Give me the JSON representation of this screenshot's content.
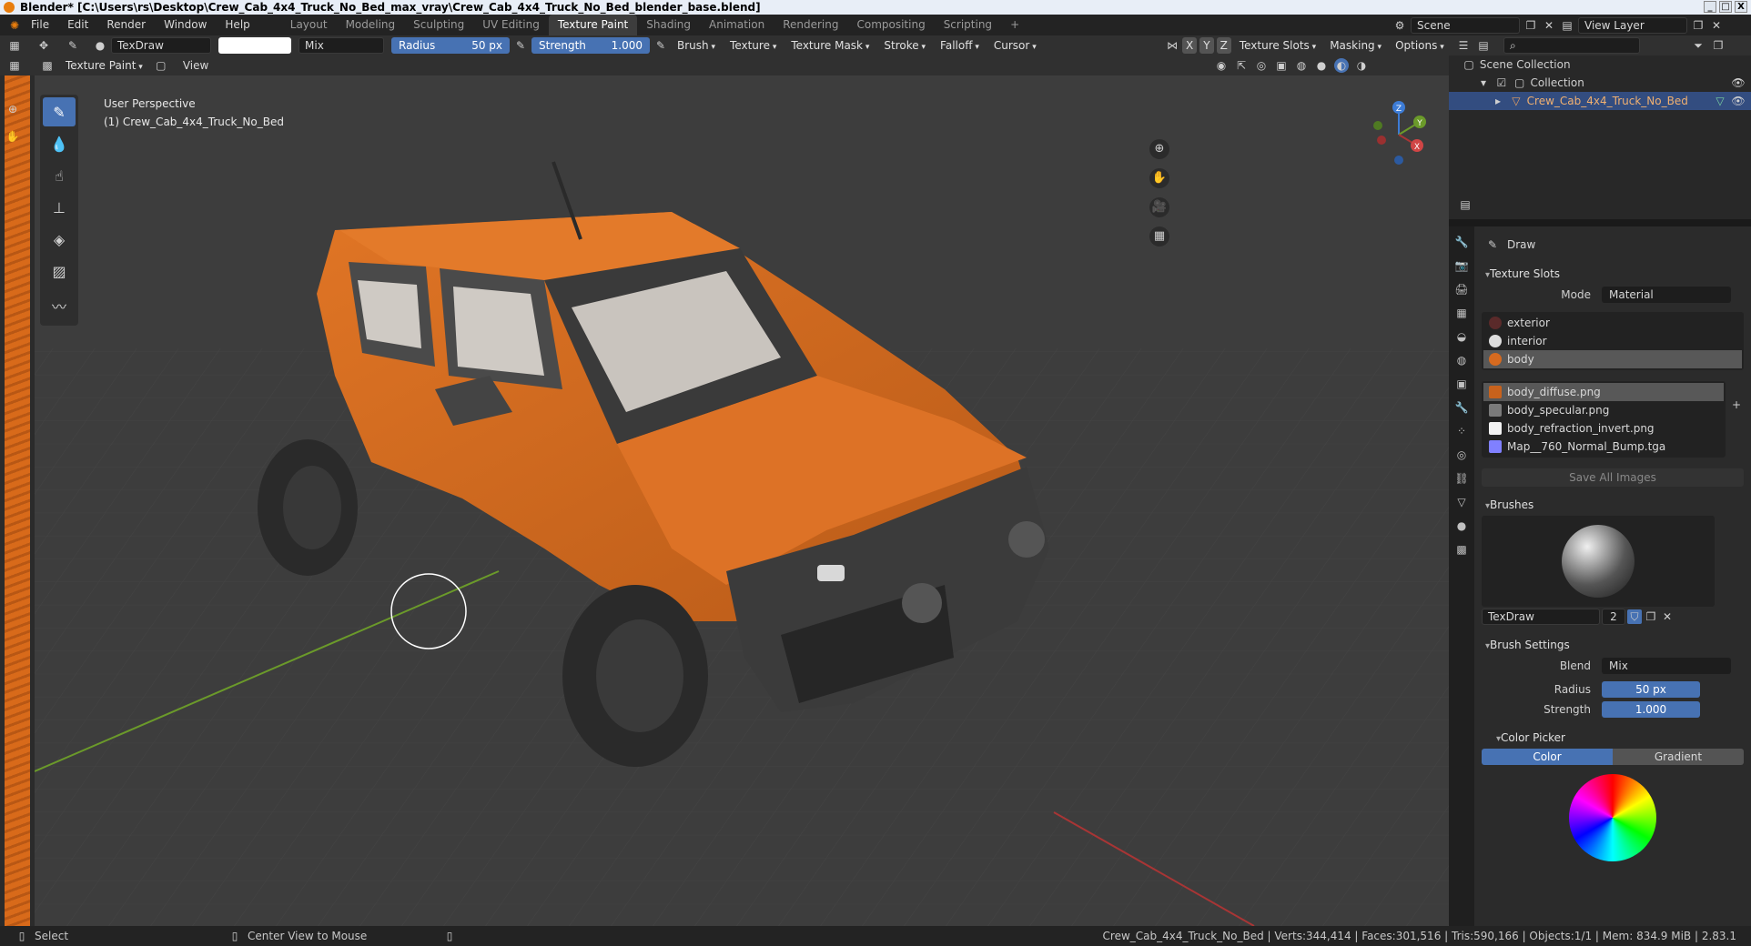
{
  "window": {
    "title": "Blender* [C:\\Users\\rs\\Desktop\\Crew_Cab_4x4_Truck_No_Bed_max_vray\\Crew_Cab_4x4_Truck_No_Bed_blender_base.blend]",
    "controls": [
      "_",
      "□",
      "X"
    ]
  },
  "menu": {
    "items": [
      "File",
      "Edit",
      "Render",
      "Window",
      "Help"
    ],
    "workspaces": [
      "Layout",
      "Modeling",
      "Sculpting",
      "UV Editing",
      "Texture Paint",
      "Shading",
      "Animation",
      "Rendering",
      "Compositing",
      "Scripting"
    ],
    "active_workspace": "Texture Paint",
    "add_workspace": "+",
    "scene_label": "Scene",
    "view_layer_label": "View Layer"
  },
  "tool_header": {
    "brush_name": "TexDraw",
    "blend_mode": "Mix",
    "radius_label": "Radius",
    "radius_value": "50 px",
    "strength_label": "Strength",
    "strength_value": "1.000",
    "dropdowns": [
      "Brush",
      "Texture",
      "Texture Mask",
      "Stroke",
      "Falloff",
      "Cursor"
    ],
    "axis_buttons": [
      "X",
      "Y",
      "Z"
    ],
    "right_dropdowns": [
      "Texture Slots",
      "Masking",
      "Options"
    ]
  },
  "editor_header": {
    "mode": "Texture Paint",
    "view_menu": "View"
  },
  "viewport": {
    "perspective_label": "User Perspective",
    "object_label": "(1) Crew_Cab_4x4_Truck_No_Bed",
    "gizmo_axes": [
      "Z",
      "Y",
      "X"
    ],
    "colors": {
      "background": "#3d3d3d",
      "truck_body": "#d66a1f",
      "x_axis": "#a83535",
      "y_axis": "#6b9a2a",
      "z_axis": "#3d7cd6"
    }
  },
  "outliner": {
    "scene_collection": "Scene Collection",
    "collection": "Collection",
    "object": "Crew_Cab_4x4_Truck_No_Bed"
  },
  "properties": {
    "tool_name": "Draw",
    "texture_slots_header": "Texture Slots",
    "mode_label": "Mode",
    "mode_value": "Material",
    "materials": [
      "exterior",
      "interior",
      "body"
    ],
    "selected_material": "body",
    "images": [
      {
        "name": "body_diffuse.png",
        "color": "#c8621c"
      },
      {
        "name": "body_specular.png",
        "color": "#7a7a7a"
      },
      {
        "name": "body_refraction_invert.png",
        "color": "#f2f2f2"
      },
      {
        "name": "Map__760_Normal_Bump.tga",
        "color": "#8080ff"
      }
    ],
    "selected_image": "body_diffuse.png",
    "save_all_label": "Save All Images",
    "brushes_header": "Brushes",
    "brush_name": "TexDraw",
    "brush_users": "2",
    "brush_settings_header": "Brush Settings",
    "blend_label": "Blend",
    "blend_value": "Mix",
    "radius_label": "Radius",
    "radius_value": "50 px",
    "strength_label": "Strength",
    "strength_value": "1.000",
    "color_picker_header": "Color Picker",
    "color_tab": "Color",
    "gradient_tab": "Gradient"
  },
  "status": {
    "select": "Select",
    "center_view": "Center View to Mouse",
    "stats": "Crew_Cab_4x4_Truck_No_Bed | Verts:344,414 | Faces:301,516 | Tris:590,166 | Objects:1/1 | Mem: 834.9 MiB | 2.83.1"
  }
}
